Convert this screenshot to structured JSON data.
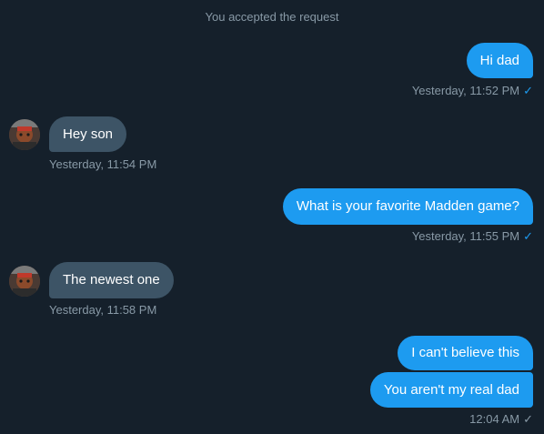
{
  "system_note": "You accepted the request",
  "messages": [
    {
      "text": "Hi dad",
      "timestamp": "Yesterday, 11:52 PM",
      "status": "read"
    },
    {
      "text": "Hey son",
      "timestamp": "Yesterday, 11:54 PM"
    },
    {
      "text": "What is your favorite Madden game?",
      "timestamp": "Yesterday, 11:55 PM",
      "status": "read"
    },
    {
      "text": "The newest one",
      "timestamp": "Yesterday, 11:58 PM"
    },
    {
      "text": "I can't believe this"
    },
    {
      "text": "You aren't my real dad",
      "timestamp": "12:04 AM",
      "status": "sent"
    }
  ],
  "status_icons": {
    "read": "✓",
    "sent": "✓"
  },
  "colors": {
    "background": "#15202b",
    "outgoing_bubble": "#1d9bf0",
    "incoming_bubble": "#3d5466",
    "meta_text": "#8899a6"
  }
}
